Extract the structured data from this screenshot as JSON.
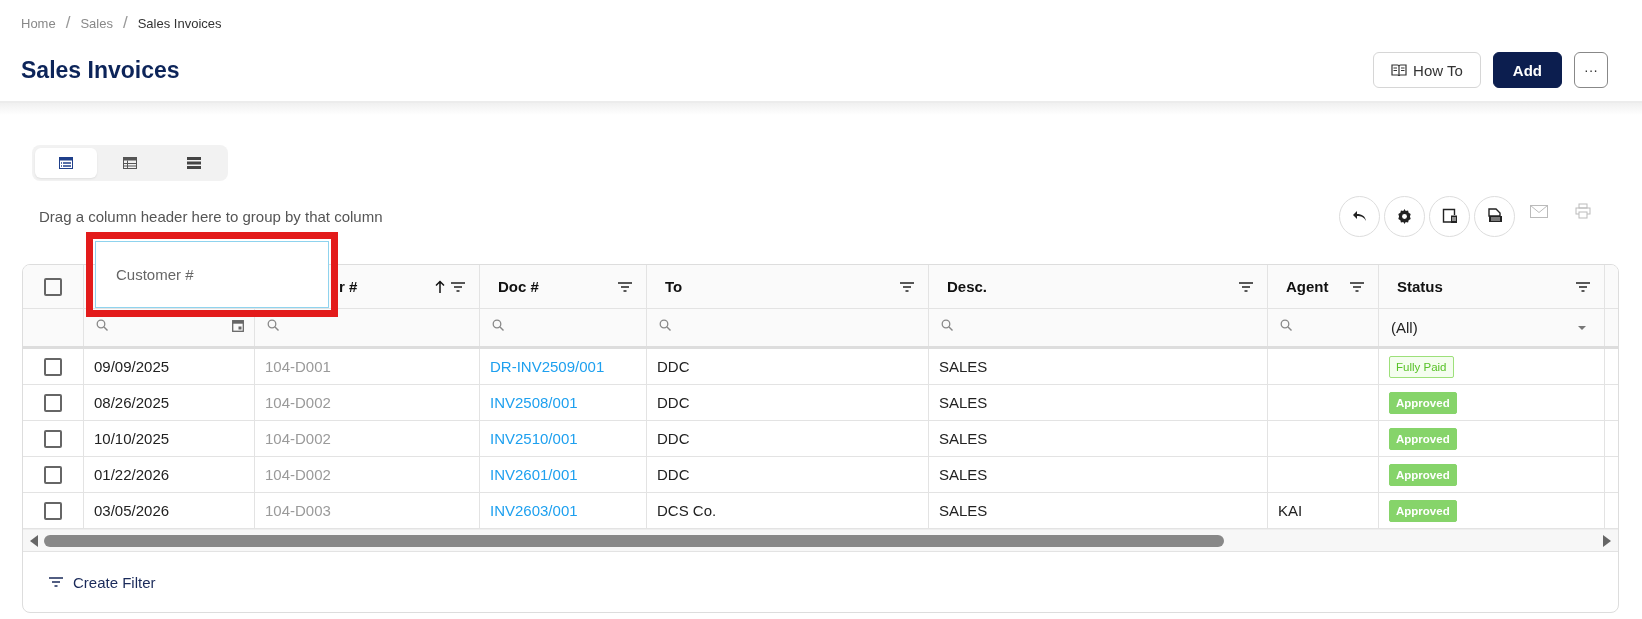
{
  "breadcrumb": {
    "items": [
      "Home",
      "Sales",
      "Sales Invoices"
    ],
    "separators": [
      "/",
      "/"
    ]
  },
  "title": "Sales Invoices",
  "actions": {
    "how_to": "How To",
    "add": "Add",
    "more": "···"
  },
  "view_modes": [
    {
      "kind": "list",
      "selected": true
    },
    {
      "kind": "table",
      "selected": false
    },
    {
      "kind": "compact",
      "selected": false
    }
  ],
  "group_panel": {
    "hint": "Drag a column header here to group by that column"
  },
  "toolbar": [
    {
      "kind": "undo",
      "disabled": false
    },
    {
      "kind": "settings",
      "disabled": false
    },
    {
      "kind": "columns",
      "disabled": false
    },
    {
      "kind": "export",
      "disabled": false
    },
    {
      "kind": "mail",
      "disabled": true
    },
    {
      "kind": "print",
      "disabled": true
    }
  ],
  "drag_ghost": {
    "label": "Customer #"
  },
  "table": {
    "columns": [
      {
        "filter": {
          "kind": "date"
        }
      },
      {
        "label": "r #",
        "sorted_ascending": true,
        "filter": {
          "kind": "search"
        }
      },
      {
        "label": "Doc #",
        "filter": {
          "kind": "search"
        }
      },
      {
        "label": "To",
        "filter": {
          "kind": "search"
        }
      },
      {
        "label": "Desc.",
        "filter": {
          "kind": "search"
        }
      },
      {
        "label": "Agent",
        "filter": {
          "kind": "search"
        }
      },
      {
        "label": "Status",
        "filter": {
          "kind": "select",
          "value": "(All)"
        }
      }
    ],
    "select_all_checked": false,
    "rows": [
      {
        "checked": false,
        "date": "09/09/2025",
        "customer": "104-D001",
        "doc": "DR-INV2509/001",
        "to": "DDC",
        "desc": "SALES",
        "status": {
          "label": "Fully Paid",
          "kind": "outline"
        }
      },
      {
        "checked": false,
        "date": "08/26/2025",
        "customer": "104-D002",
        "doc": "INV2508/001",
        "to": "DDC",
        "desc": "SALES",
        "status": {
          "label": "Approved",
          "kind": "solid"
        }
      },
      {
        "checked": false,
        "date": "10/10/2025",
        "customer": "104-D002",
        "doc": "INV2510/001",
        "to": "DDC",
        "desc": "SALES",
        "status": {
          "label": "Approved",
          "kind": "solid"
        }
      },
      {
        "checked": false,
        "date": "01/22/2026",
        "customer": "104-D002",
        "doc": "INV2601/001",
        "to": "DDC",
        "desc": "SALES",
        "status": {
          "label": "Approved",
          "kind": "solid"
        }
      },
      {
        "checked": false,
        "date": "03/05/2026",
        "customer": "104-D003",
        "doc": "INV2603/001",
        "to": "DCS Co.",
        "desc": "SALES",
        "agent": "KAI",
        "status": {
          "label": "Approved",
          "kind": "solid"
        }
      }
    ]
  },
  "footer": {
    "create_filter": "Create Filter"
  }
}
